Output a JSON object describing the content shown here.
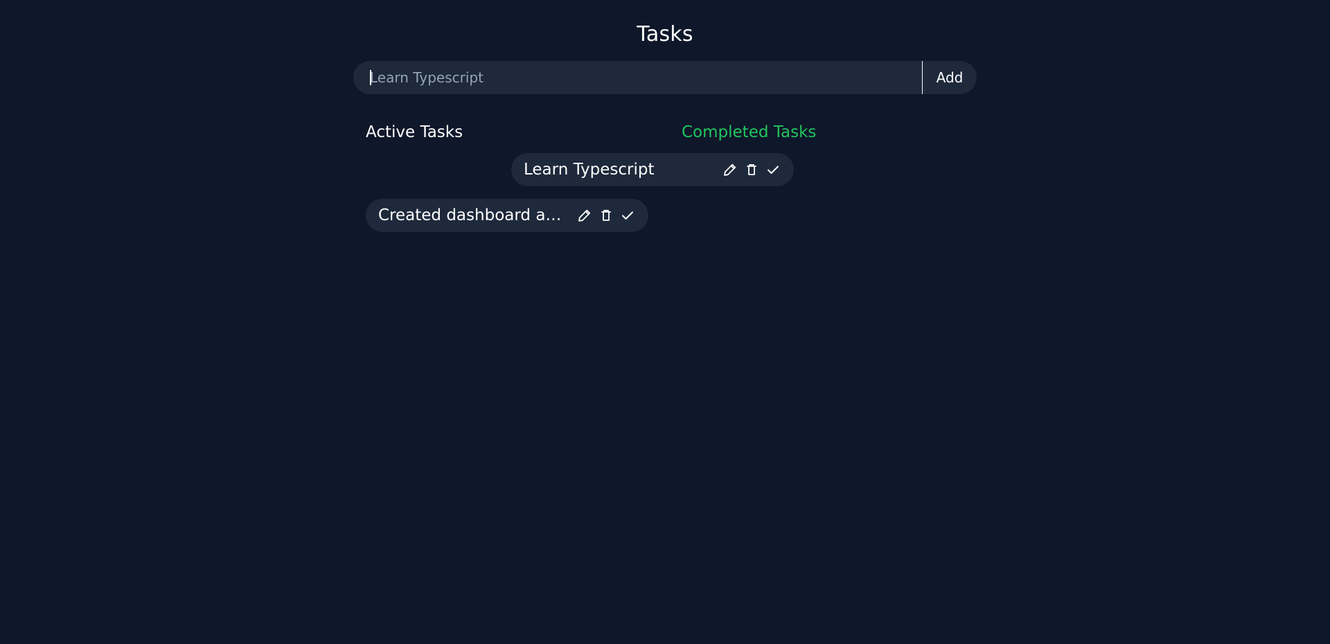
{
  "header": {
    "title": "Tasks"
  },
  "form": {
    "input_placeholder": "Learn Typescript",
    "input_value": "",
    "add_label": "Add"
  },
  "sections": {
    "active_label": "Active Tasks",
    "completed_label": "Completed Tasks"
  },
  "tasks": [
    {
      "text": "Learn Typescript"
    },
    {
      "text": "Created dashboard ad..."
    }
  ],
  "icons": {
    "edit": "pencil-icon",
    "delete": "trash-icon",
    "complete": "check-icon"
  },
  "colors": {
    "background": "#0f172a",
    "surface": "#1e293b",
    "text": "#ffffff",
    "placeholder": "#94a3b8",
    "accent": "#22c55e"
  }
}
